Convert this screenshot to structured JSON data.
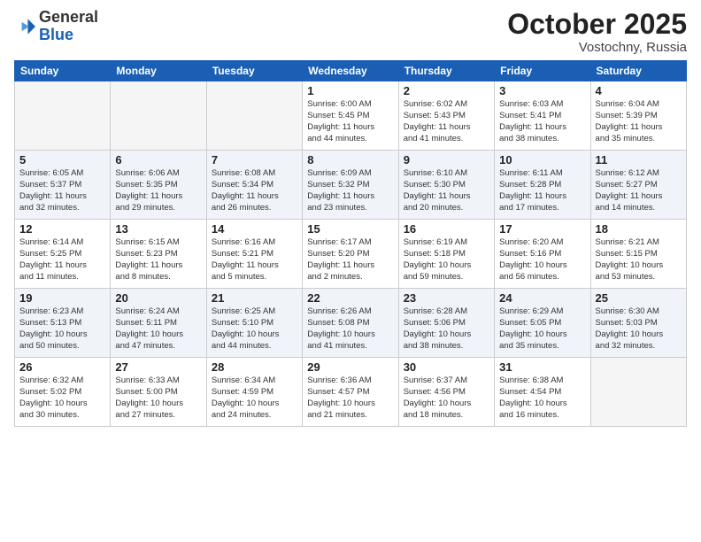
{
  "header": {
    "logo": {
      "general": "General",
      "blue": "Blue"
    },
    "title": "October 2025",
    "location": "Vostochny, Russia"
  },
  "weekdays": [
    "Sunday",
    "Monday",
    "Tuesday",
    "Wednesday",
    "Thursday",
    "Friday",
    "Saturday"
  ],
  "weeks": [
    [
      {
        "day": "",
        "info": ""
      },
      {
        "day": "",
        "info": ""
      },
      {
        "day": "",
        "info": ""
      },
      {
        "day": "1",
        "info": "Sunrise: 6:00 AM\nSunset: 5:45 PM\nDaylight: 11 hours\nand 44 minutes."
      },
      {
        "day": "2",
        "info": "Sunrise: 6:02 AM\nSunset: 5:43 PM\nDaylight: 11 hours\nand 41 minutes."
      },
      {
        "day": "3",
        "info": "Sunrise: 6:03 AM\nSunset: 5:41 PM\nDaylight: 11 hours\nand 38 minutes."
      },
      {
        "day": "4",
        "info": "Sunrise: 6:04 AM\nSunset: 5:39 PM\nDaylight: 11 hours\nand 35 minutes."
      }
    ],
    [
      {
        "day": "5",
        "info": "Sunrise: 6:05 AM\nSunset: 5:37 PM\nDaylight: 11 hours\nand 32 minutes."
      },
      {
        "day": "6",
        "info": "Sunrise: 6:06 AM\nSunset: 5:35 PM\nDaylight: 11 hours\nand 29 minutes."
      },
      {
        "day": "7",
        "info": "Sunrise: 6:08 AM\nSunset: 5:34 PM\nDaylight: 11 hours\nand 26 minutes."
      },
      {
        "day": "8",
        "info": "Sunrise: 6:09 AM\nSunset: 5:32 PM\nDaylight: 11 hours\nand 23 minutes."
      },
      {
        "day": "9",
        "info": "Sunrise: 6:10 AM\nSunset: 5:30 PM\nDaylight: 11 hours\nand 20 minutes."
      },
      {
        "day": "10",
        "info": "Sunrise: 6:11 AM\nSunset: 5:28 PM\nDaylight: 11 hours\nand 17 minutes."
      },
      {
        "day": "11",
        "info": "Sunrise: 6:12 AM\nSunset: 5:27 PM\nDaylight: 11 hours\nand 14 minutes."
      }
    ],
    [
      {
        "day": "12",
        "info": "Sunrise: 6:14 AM\nSunset: 5:25 PM\nDaylight: 11 hours\nand 11 minutes."
      },
      {
        "day": "13",
        "info": "Sunrise: 6:15 AM\nSunset: 5:23 PM\nDaylight: 11 hours\nand 8 minutes."
      },
      {
        "day": "14",
        "info": "Sunrise: 6:16 AM\nSunset: 5:21 PM\nDaylight: 11 hours\nand 5 minutes."
      },
      {
        "day": "15",
        "info": "Sunrise: 6:17 AM\nSunset: 5:20 PM\nDaylight: 11 hours\nand 2 minutes."
      },
      {
        "day": "16",
        "info": "Sunrise: 6:19 AM\nSunset: 5:18 PM\nDaylight: 10 hours\nand 59 minutes."
      },
      {
        "day": "17",
        "info": "Sunrise: 6:20 AM\nSunset: 5:16 PM\nDaylight: 10 hours\nand 56 minutes."
      },
      {
        "day": "18",
        "info": "Sunrise: 6:21 AM\nSunset: 5:15 PM\nDaylight: 10 hours\nand 53 minutes."
      }
    ],
    [
      {
        "day": "19",
        "info": "Sunrise: 6:23 AM\nSunset: 5:13 PM\nDaylight: 10 hours\nand 50 minutes."
      },
      {
        "day": "20",
        "info": "Sunrise: 6:24 AM\nSunset: 5:11 PM\nDaylight: 10 hours\nand 47 minutes."
      },
      {
        "day": "21",
        "info": "Sunrise: 6:25 AM\nSunset: 5:10 PM\nDaylight: 10 hours\nand 44 minutes."
      },
      {
        "day": "22",
        "info": "Sunrise: 6:26 AM\nSunset: 5:08 PM\nDaylight: 10 hours\nand 41 minutes."
      },
      {
        "day": "23",
        "info": "Sunrise: 6:28 AM\nSunset: 5:06 PM\nDaylight: 10 hours\nand 38 minutes."
      },
      {
        "day": "24",
        "info": "Sunrise: 6:29 AM\nSunset: 5:05 PM\nDaylight: 10 hours\nand 35 minutes."
      },
      {
        "day": "25",
        "info": "Sunrise: 6:30 AM\nSunset: 5:03 PM\nDaylight: 10 hours\nand 32 minutes."
      }
    ],
    [
      {
        "day": "26",
        "info": "Sunrise: 6:32 AM\nSunset: 5:02 PM\nDaylight: 10 hours\nand 30 minutes."
      },
      {
        "day": "27",
        "info": "Sunrise: 6:33 AM\nSunset: 5:00 PM\nDaylight: 10 hours\nand 27 minutes."
      },
      {
        "day": "28",
        "info": "Sunrise: 6:34 AM\nSunset: 4:59 PM\nDaylight: 10 hours\nand 24 minutes."
      },
      {
        "day": "29",
        "info": "Sunrise: 6:36 AM\nSunset: 4:57 PM\nDaylight: 10 hours\nand 21 minutes."
      },
      {
        "day": "30",
        "info": "Sunrise: 6:37 AM\nSunset: 4:56 PM\nDaylight: 10 hours\nand 18 minutes."
      },
      {
        "day": "31",
        "info": "Sunrise: 6:38 AM\nSunset: 4:54 PM\nDaylight: 10 hours\nand 16 minutes."
      },
      {
        "day": "",
        "info": ""
      }
    ]
  ]
}
